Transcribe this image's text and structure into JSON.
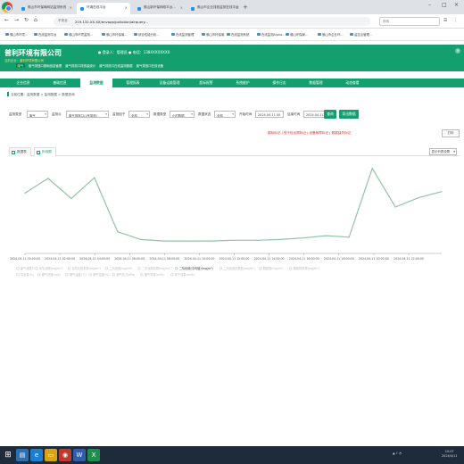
{
  "browser": {
    "tabs": [
      {
        "label": "佛山市环保局网站监测系统"
      },
      {
        "label": "环境在线平台"
      },
      {
        "label": "佛山新环保网络平台..."
      },
      {
        "label": "佛山市企业排放监测在线平台"
      }
    ],
    "url": "219.132.XX.XX/envapp/pollution/airquery...",
    "security_label": "不安全",
    "side_search_placeholder": "搜索"
  },
  "bookmarks": [
    "佛山市环境...",
    "在线监测平台",
    "佛山市环境监测...",
    "佛山市环保局...",
    "综合性能分析...",
    "在线监测管理",
    "佛山市环保局",
    "在线监测系统",
    "在线监测Alpha...",
    "佛山环保局...",
    "佛山市企业环...",
    "监控点管理..."
  ],
  "header": {
    "company": "普利环境有限公司",
    "user_info": "● 登录人：管理员   ● 电话：138XXXXXXXX",
    "subtitle": "当前企业：普利环境有限公司",
    "sublinks": [
      "废气",
      "废气排放口基础信息管理",
      "废气排放口排放量统计",
      "废气排放口在线监测数据",
      "废气排放口在线设备"
    ],
    "close_label": "×"
  },
  "modules": [
    {
      "label": "企业信息"
    },
    {
      "label": "基础信息"
    },
    {
      "label": "监测数据"
    },
    {
      "label": "管理报表"
    },
    {
      "label": "设备运维管理"
    },
    {
      "label": "超标报警"
    },
    {
      "label": "系统维护"
    },
    {
      "label": "操作日志"
    },
    {
      "label": "数据管理"
    },
    {
      "label": "动态查看"
    }
  ],
  "active_module_index": 2,
  "breadcrumb": "当前位置：监测数据 > 监测数据 > 数据查询",
  "filters": {
    "monitor_type_label": "监测类型",
    "monitor_type": "废气",
    "outlet_label": "监测点",
    "outlet": "废气排放口(1号排放)",
    "factor_label": "监测因子",
    "factor": "全部",
    "data_type_label": "数据类型",
    "data_type": "小时数据",
    "state_label": "数据状态",
    "state": "全部",
    "start_label": "开始时间",
    "start": "2024-04-11 00",
    "end_label": "结束时间",
    "end": "2024-04-11 23",
    "query_label": "查询",
    "export_label": "导出数据"
  },
  "warnings": "超标标记 | 低于检出限标记 | 设备故障标记 | 数据缺失标记",
  "print_label": "打印",
  "view_tabs": [
    {
      "label": "数据表"
    },
    {
      "label": "折线图"
    }
  ],
  "active_view": 1,
  "display_columns_label": "显示列表设置",
  "chart_data": {
    "type": "line",
    "x": [
      "2024-04-11 00:00",
      "2024-04-11 02:00",
      "2024-04-11 04:00",
      "2024-04-11 06:00",
      "2024-04-11 08:00",
      "2024-04-11 10:00",
      "2024-04-11 12:00",
      "2024-04-11 14:00",
      "2024-04-11 16:00",
      "2024-04-11 18:00",
      "2024-04-11 20:00",
      "2024-04-11 22:00"
    ],
    "x_ticks": [
      "2024-04-11 00:00:00",
      "2024-04-11 02:00:00",
      "2024-04-11 04:00:00",
      "2024-04-11 06:00:00",
      "2024-04-11 08:00:00",
      "2024-04-11 10:00:00",
      "2024-04-11 12:00:00",
      "2024-04-11 14:00:00",
      "2024-04-11 16:00:00",
      "2024-04-11 18:00:00",
      "2024-04-11 20:00:00",
      "2024-04-11 22:00:00"
    ],
    "series": [
      {
        "name": "二氧化硫(平均值)",
        "values": [
          78,
          97,
          71,
          98,
          28,
          18,
          16,
          16,
          16,
          17,
          17,
          18,
          20,
          23,
          21,
          110,
          60,
          72,
          80
        ]
      }
    ],
    "ylim": [
      0,
      120
    ],
    "grid": false,
    "legend_position": "bottom",
    "line_color": "#8fc3a8",
    "legend": [
      {
        "name": "废气排放口",
        "active": false
      },
      {
        "name": "氮氧化物(mg/m³)",
        "active": false
      },
      {
        "name": "氮氧化物折算(mg/m³)",
        "active": false
      },
      {
        "name": "二氧化硫(mg/m³)",
        "active": false
      },
      {
        "name": "二氧化硫折算(mg/m³)",
        "active": false
      },
      {
        "name": "二氧化硫(平均值)(mg/m³)",
        "active": true
      },
      {
        "name": "二氧化硫折算值(mg/m³)",
        "active": false
      },
      {
        "name": "颗粒物(mg/m³)",
        "active": false
      },
      {
        "name": "颗粒物折算(mg/m³)",
        "active": false
      },
      {
        "name": "氧含量(%)",
        "active": false
      },
      {
        "name": "烟气流速(m/s)",
        "active": false
      },
      {
        "name": "烟气温度(℃)",
        "active": false
      },
      {
        "name": "烟气湿度(%)",
        "active": false
      },
      {
        "name": "烟气压力(kPa)",
        "active": false
      },
      {
        "name": "烟气流量(m³/h)",
        "active": false
      },
      {
        "name": "标干流量(m³/h)",
        "active": false
      }
    ]
  },
  "taskbar": {
    "clock_time": "10:07",
    "clock_date": "2024/4/11"
  }
}
